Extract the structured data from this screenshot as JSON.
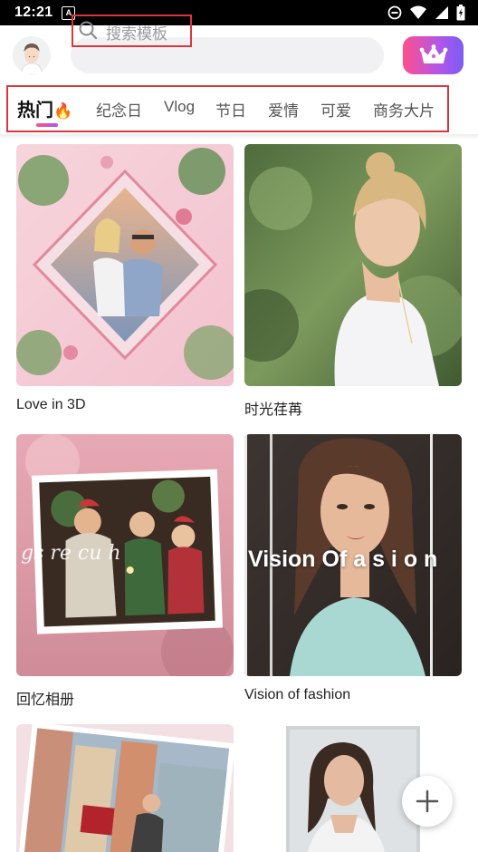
{
  "status_bar": {
    "time": "12:21",
    "notification_icon": "A"
  },
  "search": {
    "placeholder": "搜索模板"
  },
  "tabs": [
    {
      "label": "热门",
      "emoji": "🔥"
    },
    {
      "label": "纪念日"
    },
    {
      "label": "Vlog"
    },
    {
      "label": "节日"
    },
    {
      "label": "爱情"
    },
    {
      "label": "可爱"
    },
    {
      "label": "商务大片"
    }
  ],
  "templates": [
    {
      "title": "Love in 3D"
    },
    {
      "title": "时光荏苒"
    },
    {
      "title": "回忆相册"
    },
    {
      "title": "Vision of  fashion",
      "overlay_text": "Vision Of   a s i o n"
    },
    {
      "title": ""
    },
    {
      "title": ""
    }
  ],
  "colors": {
    "accent_start": "#ff4f8b",
    "accent_end": "#7b5cf5",
    "highlight": "#d9363e"
  },
  "icons": [
    "avatar-icon",
    "search-icon",
    "crown-icon",
    "flame-icon",
    "plus-icon",
    "wifi-icon",
    "battery-icon",
    "dnd-icon"
  ]
}
